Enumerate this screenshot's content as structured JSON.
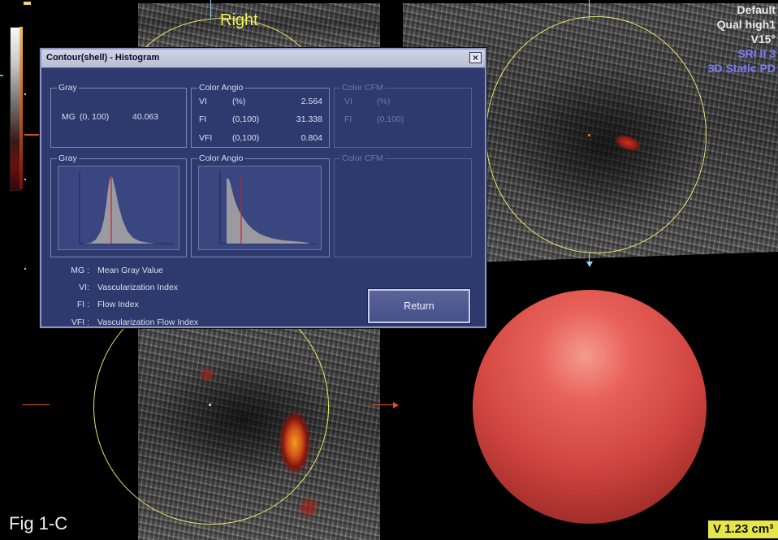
{
  "view": {
    "orientation_label": "Right",
    "figure_label": "Fig 1-C",
    "volume": "V 1.23 cm³"
  },
  "settings": {
    "lines": [
      {
        "text": "Default",
        "color": "#e8e8e8"
      },
      {
        "text": "Qual high1",
        "color": "#e8e8e8"
      },
      {
        "text": "V15°",
        "color": "#e8e8e8"
      },
      {
        "text": "SRI II 3",
        "color": "#7b7bff"
      },
      {
        "text": "3D Static PD",
        "color": "#7b7bff"
      }
    ]
  },
  "dialog": {
    "title": "Contour(shell) - Histogram",
    "close_icon": "close-icon",
    "groups": {
      "gray": {
        "label": "Gray",
        "rows": [
          {
            "name": "MG",
            "range": "(0, 100)",
            "value": "40.063"
          }
        ]
      },
      "color_angio": {
        "label": "Color Angio",
        "rows": [
          {
            "name": "VI",
            "range": "(%)",
            "value": "2.564"
          },
          {
            "name": "FI",
            "range": "(0,100)",
            "value": "31.338"
          },
          {
            "name": "VFI",
            "range": "(0,100)",
            "value": "0.804"
          }
        ]
      },
      "color_cfm": {
        "label": "Color CFM",
        "rows": [
          {
            "name": "VI",
            "range": "(%)"
          },
          {
            "name": "FI",
            "range": "(0,100)"
          }
        ]
      }
    },
    "histograms": {
      "gray": {
        "label": "Gray"
      },
      "color_angio": {
        "label": "Color Angio"
      },
      "color_cfm": {
        "label": "Color CFM"
      }
    },
    "legend": [
      {
        "key": "MG :",
        "desc": "Mean Gray Value"
      },
      {
        "key": "VI:",
        "desc": "Vascularization Index"
      },
      {
        "key": "FI :",
        "desc": "Flow Index"
      },
      {
        "key": "VFI :",
        "desc": "Vascularization Flow Index"
      }
    ],
    "return_label": "Return"
  },
  "colors": {
    "dialog_bg": "#2e3a6e",
    "ring": "#e6e66a",
    "sphere": "#e65a55",
    "volume_bg": "#e6e64a",
    "histogram_fill": "#9a9aa0",
    "histogram_marker": "#d02020"
  }
}
